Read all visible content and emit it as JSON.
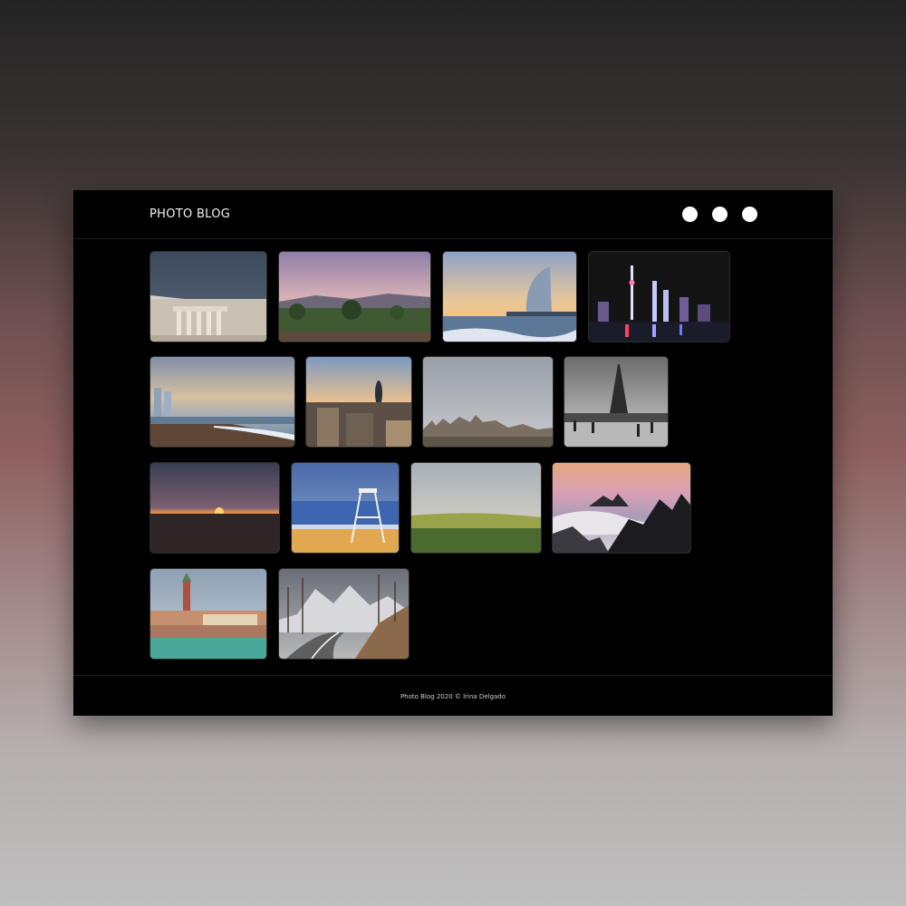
{
  "header": {
    "brand": "PHOTO BLOG",
    "menu_dots": [
      "dot",
      "dot",
      "dot"
    ]
  },
  "gallery": {
    "photos": [
      {
        "subject": "acropolis-temple"
      },
      {
        "subject": "pastel-hills-landscape"
      },
      {
        "subject": "sail-hotel-seafront"
      },
      {
        "subject": "night-city-skyline"
      },
      {
        "subject": "beach-towers"
      },
      {
        "subject": "city-rooftops-tower"
      },
      {
        "subject": "castle-cloudy-sky"
      },
      {
        "subject": "eiffel-tower-bw"
      },
      {
        "subject": "sunset-field"
      },
      {
        "subject": "lifeguard-tower-beach"
      },
      {
        "subject": "green-meadow"
      },
      {
        "subject": "misty-mountain-peaks"
      },
      {
        "subject": "venice-bell-tower"
      },
      {
        "subject": "mountain-road"
      }
    ]
  },
  "footer": {
    "text": "Photo Blog 2020 © Irina Delgado"
  }
}
